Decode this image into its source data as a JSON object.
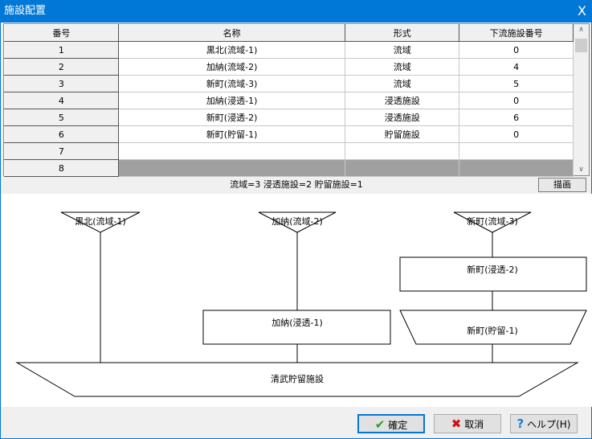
{
  "window": {
    "title": "施設配置",
    "close": "X"
  },
  "table": {
    "headers": [
      "番号",
      "名称",
      "形式",
      "下流施設番号"
    ],
    "rows": [
      {
        "no": "1",
        "name": "黒北(流域-1)",
        "type": "流域",
        "down": "0"
      },
      {
        "no": "2",
        "name": "加納(流域-2)",
        "type": "流域",
        "down": "4"
      },
      {
        "no": "3",
        "name": "新町(流域-3)",
        "type": "流域",
        "down": "5"
      },
      {
        "no": "4",
        "name": "加納(浸透-1)",
        "type": "浸透施設",
        "down": "0"
      },
      {
        "no": "5",
        "name": "新町(浸透-2)",
        "type": "浸透施設",
        "down": "6"
      },
      {
        "no": "6",
        "name": "新町(貯留-1)",
        "type": "貯留施設",
        "down": "0"
      },
      {
        "no": "7",
        "name": "",
        "type": "",
        "down": ""
      },
      {
        "no": "8",
        "name": "",
        "type": "",
        "down": ""
      }
    ]
  },
  "status": "流域=3 浸透施設=2 貯留施設=1",
  "draw_button": "描画",
  "diagram": {
    "basins": [
      "黒北(流域-1)",
      "加納(流域-2)",
      "新町(流域-3)"
    ],
    "infiltration": [
      "加納(浸透-1)",
      "新町(浸透-2)"
    ],
    "storage": "新町(貯留-1)",
    "outlet": "清武貯留施設"
  },
  "buttons": {
    "ok": "確定",
    "cancel": "取消",
    "help": "ヘルプ(H)"
  }
}
